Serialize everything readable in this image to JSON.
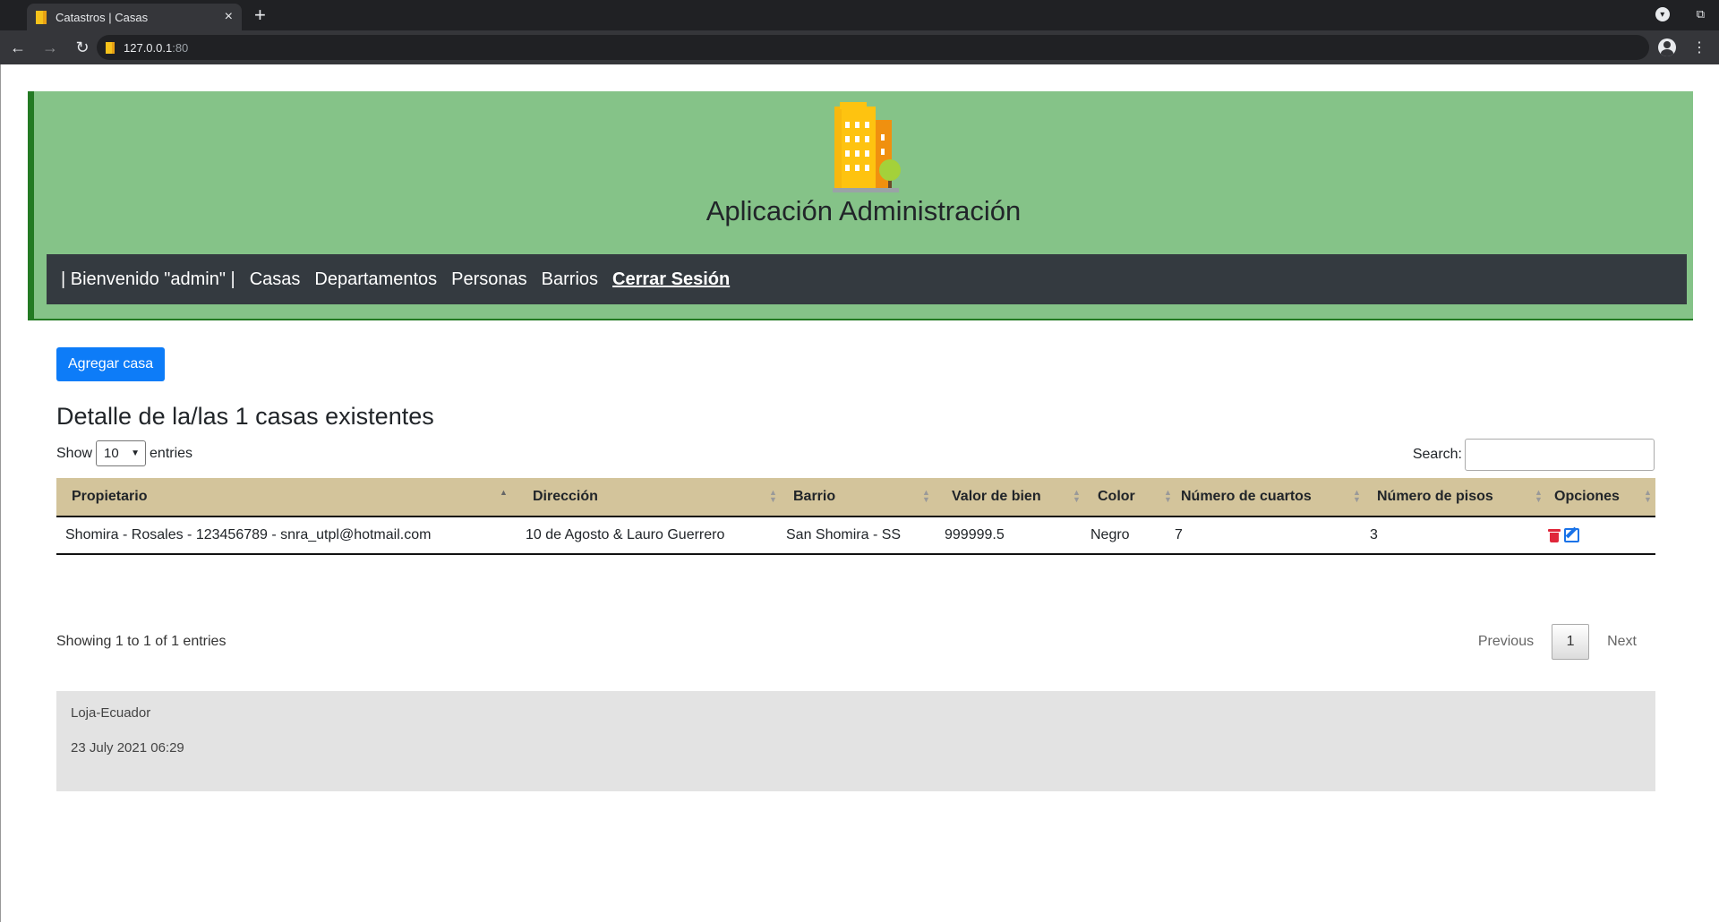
{
  "browser": {
    "tab_title": "Catastros | Casas",
    "tab_close": "×",
    "new_tab": "+",
    "url_host": "127.0.0.1",
    "url_port": ":80",
    "back": "←",
    "forward": "→",
    "reload": "↻",
    "menu": "⋮"
  },
  "header": {
    "app_title": "Aplicación Administración",
    "nav": {
      "welcome": "| Bienvenido \"admin\" |",
      "items": [
        "Casas",
        "Departamentos",
        "Personas",
        "Barrios"
      ],
      "logout": "Cerrar Sesión"
    }
  },
  "main": {
    "add_button": "Agregar casa",
    "section_title": "Detalle de la/las 1 casas existentes",
    "length": {
      "show": "Show",
      "value": "10",
      "entries": "entries"
    },
    "search": {
      "label": "Search:",
      "value": ""
    },
    "table": {
      "columns": [
        "Propietario",
        "Dirección",
        "Barrio",
        "Valor de bien",
        "Color",
        "Número de cuartos",
        "Número de pisos",
        "Opciones"
      ],
      "rows": [
        [
          "Shomira - Rosales - 123456789 - snra_utpl@hotmail.com",
          "10 de Agosto & Lauro Guerrero",
          "San Shomira - SS",
          "999999.5",
          "Negro",
          "7",
          "3"
        ]
      ]
    },
    "info": "Showing 1 to 1 of 1 entries",
    "pagination": {
      "previous": "Previous",
      "current": "1",
      "next": "Next"
    }
  },
  "footer": {
    "location": "Loja-Ecuador",
    "datetime": "23 July 2021 06:29"
  },
  "colors": {
    "header_bg": "#85c388",
    "header_border": "#237a23",
    "navbar_bg": "#343a40",
    "add_button": "#0d7cf8",
    "table_header_bg": "#d3c49b",
    "footer_bg": "#e3e3e3",
    "delete_icon": "#e0263a",
    "edit_icon": "#1a73e8"
  }
}
